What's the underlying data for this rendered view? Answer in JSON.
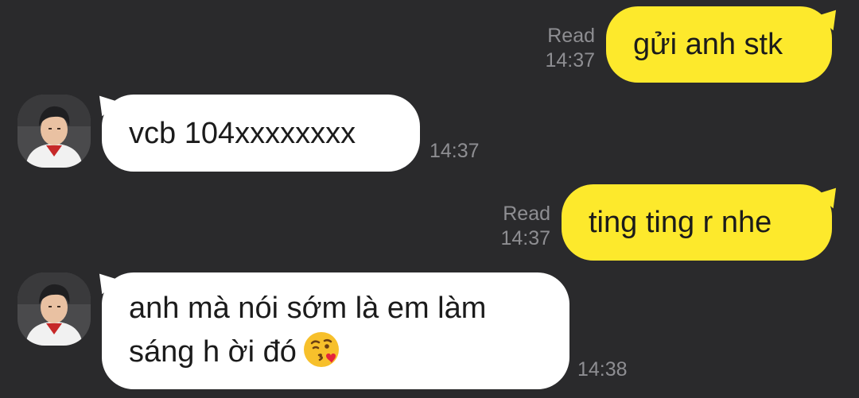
{
  "messages": [
    {
      "direction": "outgoing",
      "text": "gửi anh stk",
      "status": "Read",
      "time": "14:37"
    },
    {
      "direction": "incoming",
      "text": "vcb 104xxxxxxxx",
      "time": "14:37"
    },
    {
      "direction": "outgoing",
      "text": "ting ting r nhe",
      "status": "Read",
      "time": "14:37"
    },
    {
      "direction": "incoming",
      "lines": [
        "anh mà nói sớm là em làm",
        "sáng h ời đó"
      ],
      "emoji": "face-blowing-kiss-icon",
      "time": "14:38"
    }
  ],
  "colors": {
    "background": "#2a2a2c",
    "outgoing_bubble": "#fde92c",
    "incoming_bubble": "#ffffff",
    "meta_text": "#8e8e92"
  }
}
